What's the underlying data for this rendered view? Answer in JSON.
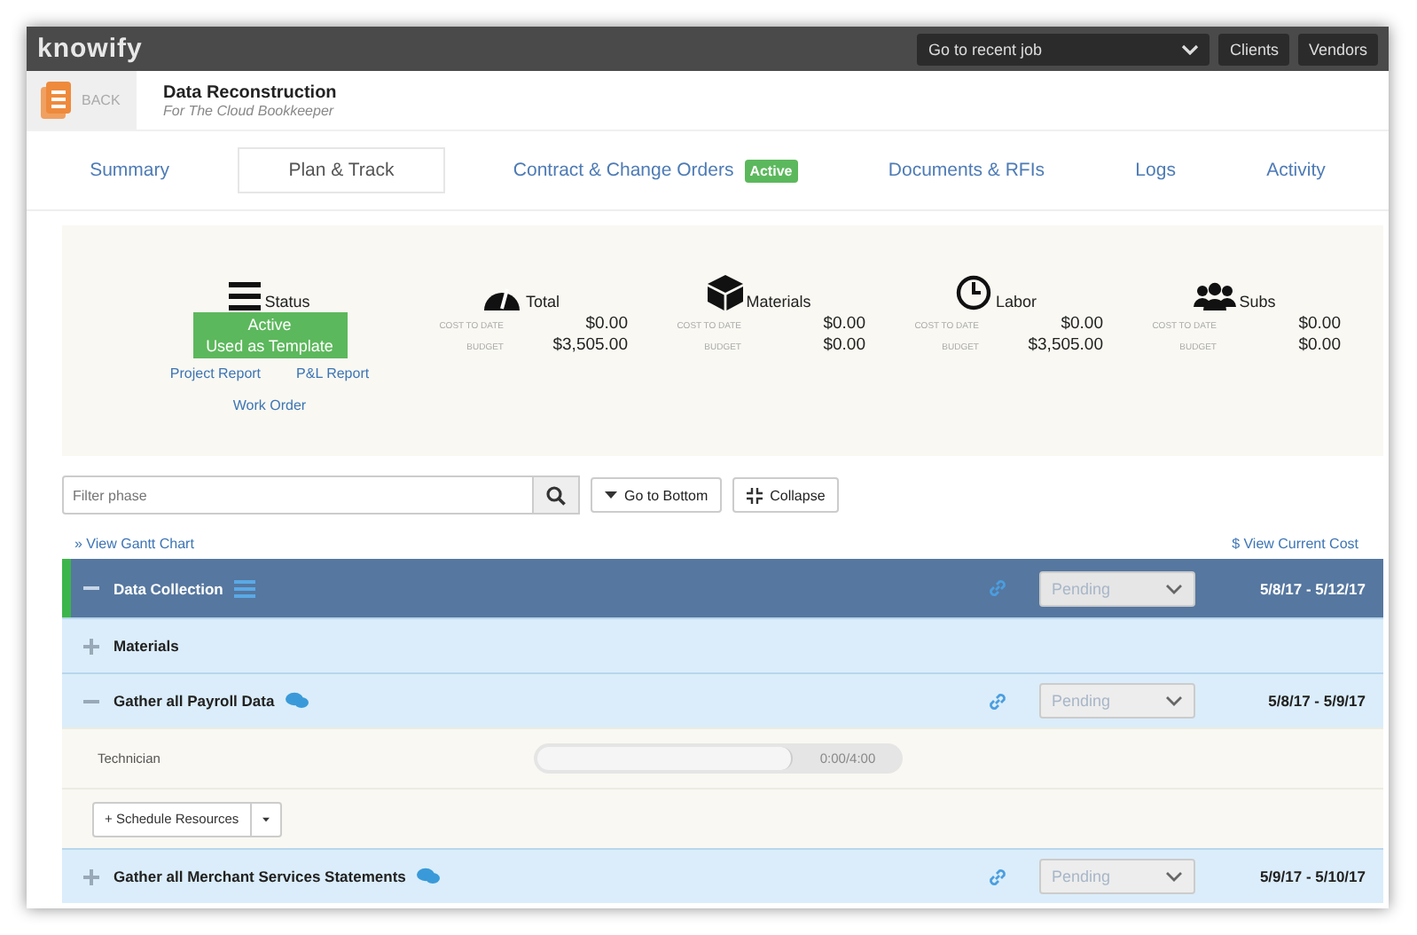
{
  "topbar": {
    "logo": "knowify",
    "recent_job": {
      "value": "Go to recent job"
    },
    "buttons": [
      "Clients",
      "Vendors"
    ]
  },
  "header": {
    "back": "BACK",
    "title": "Data Reconstruction",
    "subtitle": "For The Cloud Bookkeeper"
  },
  "tabs": [
    {
      "label": "Summary",
      "selected": false
    },
    {
      "label": "Plan & Track",
      "selected": true
    },
    {
      "label": "Contract & Change Orders",
      "selected": false,
      "badge": "Active"
    },
    {
      "label": "Documents & RFIs",
      "selected": false
    },
    {
      "label": "Logs",
      "selected": false
    },
    {
      "label": "Activity",
      "selected": false
    }
  ],
  "summary": {
    "status": {
      "label": "Status",
      "badge": [
        "Active",
        "Used as Template"
      ],
      "links": [
        "Project Report",
        "P&L Report",
        "Work Order"
      ]
    },
    "stats": [
      {
        "kind": "total",
        "label": "Total",
        "rows": [
          {
            "label": "COST TO DATE",
            "value": "$0.00"
          },
          {
            "label": "BUDGET",
            "value": "$3,505.00"
          }
        ]
      },
      {
        "kind": "materials",
        "label": "Materials",
        "rows": [
          {
            "label": "COST TO DATE",
            "value": "$0.00"
          },
          {
            "label": "BUDGET",
            "value": "$0.00"
          }
        ]
      },
      {
        "kind": "labor",
        "label": "Labor",
        "rows": [
          {
            "label": "COST TO DATE",
            "value": "$0.00"
          },
          {
            "label": "BUDGET",
            "value": "$3,505.00"
          }
        ]
      },
      {
        "kind": "subs",
        "label": "Subs",
        "rows": [
          {
            "label": "COST TO DATE",
            "value": "$0.00"
          },
          {
            "label": "BUDGET",
            "value": "$0.00"
          }
        ]
      }
    ]
  },
  "toolbar": {
    "filter": {
      "placeholder": "Filter phase"
    },
    "buttons": [
      "Go to Bottom",
      "Collapse"
    ]
  },
  "links": {
    "gantt": "» View Gantt Chart",
    "cost": "$ View Current Cost"
  },
  "rows": [
    {
      "kind": "phase",
      "name": "Data Collection",
      "expanded": true,
      "status": "Pending",
      "dates": "5/8/17 - 5/12/17"
    },
    {
      "kind": "group",
      "name": "Materials",
      "expanded": false
    },
    {
      "kind": "task",
      "name": "Gather all Payroll Data",
      "expanded": true,
      "status": "Pending",
      "dates": "5/8/17 - 5/9/17"
    },
    {
      "kind": "resource",
      "name": "Technician",
      "level": 0,
      "reading": "0:00/4:00"
    },
    {
      "kind": "actions",
      "button": "+ Schedule Resources"
    },
    {
      "kind": "task",
      "name": "Gather all Merchant Services Statements",
      "expanded": false,
      "status": "Pending",
      "dates": "5/9/17 - 5/10/17"
    }
  ]
}
